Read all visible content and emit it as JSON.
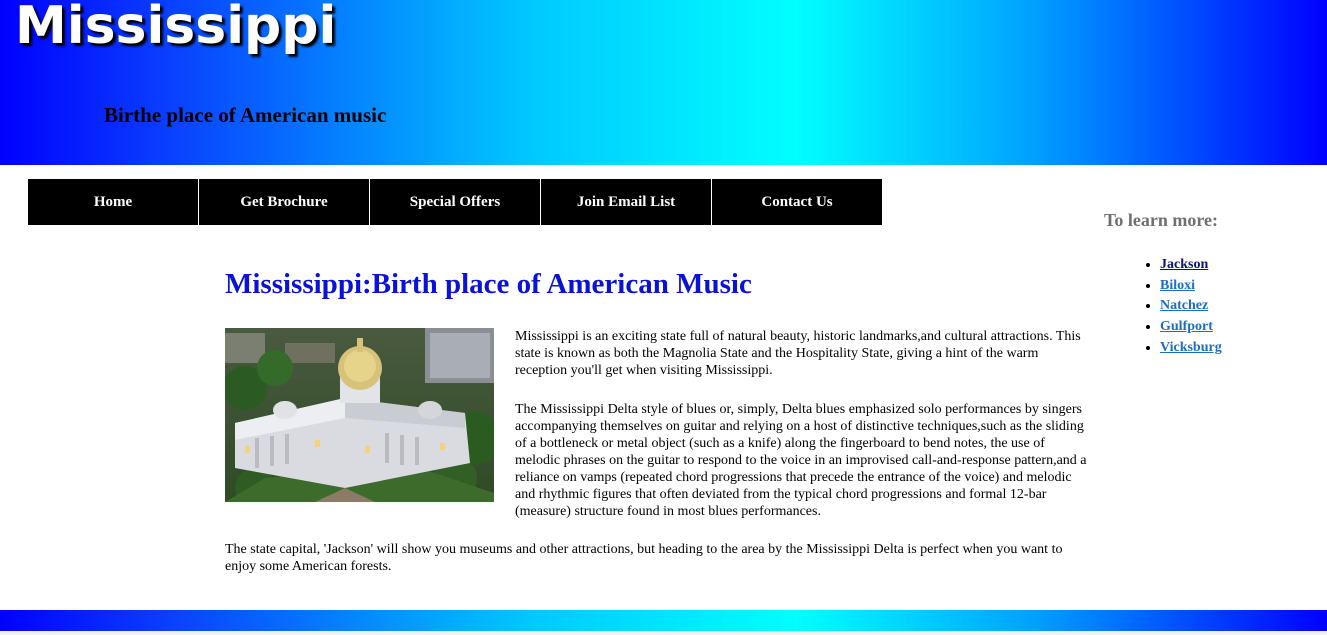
{
  "header": {
    "title": "Mississippi",
    "tagline": "Birthe place of American music"
  },
  "nav": [
    {
      "label": "Home"
    },
    {
      "label": "Get Brochure"
    },
    {
      "label": "Special Offers"
    },
    {
      "label": "Join Email List"
    },
    {
      "label": "Contact Us"
    }
  ],
  "main": {
    "heading": "Mississippi:Birth place of American Music",
    "paragraph1": "Mississippi is an exciting state full of natural beauty, historic landmarks,and cultural attractions. This state is known as both the Magnolia State and the Hospitality State, giving a hint of the warm reception you'll get when visiting Mississippi.",
    "paragraph2": "The Mississippi Delta style of blues or, simply, Delta blues emphasized solo performances by singers accompanying themselves on guitar and relying on a host of distinctive techniques,such as the sliding of a bottleneck or metal object (such as a knife) along the fingerboard to bend notes, the use of melodic phrases on the guitar to respond to the voice in an improvised call-and-response pattern,and a reliance on vamps (repeated chord progressions that precede the entrance of the voice) and melodic and rhythmic figures that often deviated from the typical chord progressions and formal 12-bar (measure) structure found in most blues performances.",
    "paragraph3": "The state capital, 'Jackson' will show you museums and other attractions, but heading to the area by the Mississippi Delta is perfect when you want to enjoy some American forests."
  },
  "aside": {
    "heading": "To learn more:",
    "links": [
      {
        "label": "Jackson"
      },
      {
        "label": "Biloxi"
      },
      {
        "label": "Natchez"
      },
      {
        "label": "Gulfport"
      },
      {
        "label": "Vicksburg"
      }
    ]
  },
  "colors": {
    "heading_blue": "#0a12d8",
    "nav_bg": "#000000",
    "link_blue": "#1a6fc4",
    "link_visited": "#0a1080",
    "aside_heading": "#707070"
  }
}
